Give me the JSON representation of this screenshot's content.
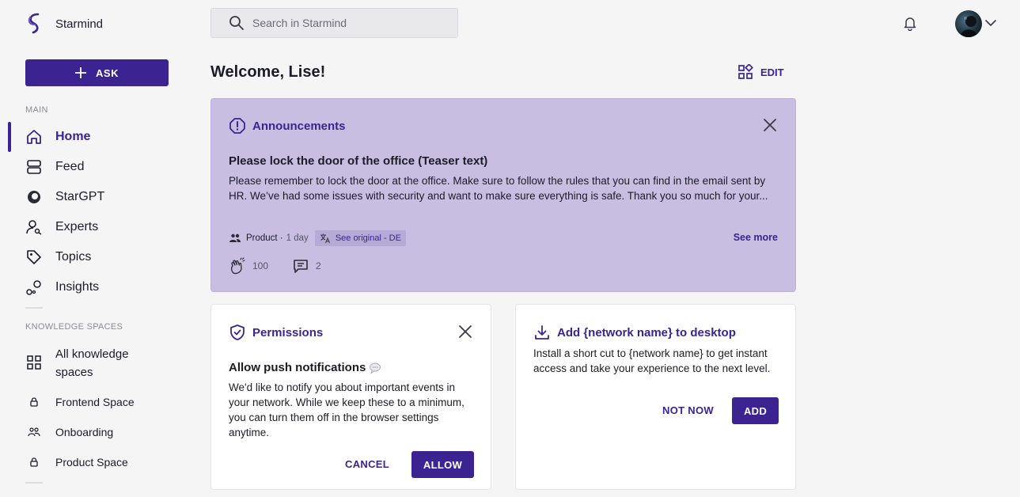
{
  "brand": {
    "name": "Starmind"
  },
  "sidebar": {
    "ask_label": "ASK",
    "main_label": "MAIN",
    "items": [
      {
        "label": "Home",
        "icon": "home-icon",
        "active": true
      },
      {
        "label": "Feed",
        "icon": "feed-icon"
      },
      {
        "label": "StarGPT",
        "icon": "stargpt-icon"
      },
      {
        "label": "Experts",
        "icon": "experts-icon"
      },
      {
        "label": "Topics",
        "icon": "tag-icon"
      },
      {
        "label": "Insights",
        "icon": "insights-icon"
      }
    ],
    "knowledge_label": "KNOWLEDGE SPACES",
    "spaces": [
      {
        "label": "All knowledge spaces",
        "icon": "grid-icon"
      },
      {
        "label": "Frontend Space",
        "icon": "lock-icon"
      },
      {
        "label": "Onboarding",
        "icon": "group-icon"
      },
      {
        "label": "Product Space",
        "icon": "lock-icon"
      }
    ]
  },
  "header": {
    "search_placeholder": "Search in Starmind"
  },
  "main": {
    "welcome": "Welcome,  Lise!",
    "edit_label": "EDIT",
    "announcement": {
      "heading": "Announcements",
      "title": "Please lock the door of the office (Teaser text)",
      "body": "Please remember to lock the door at the office. Make sure to follow the rules that you can find in the email sent by HR. We’ve had some issues with security and want to make sure everything is safe. Thank you so much for your...",
      "space": "Product ·",
      "time": "1 day",
      "see_original": "See original - DE",
      "see_more": "See more",
      "claps": "100",
      "comments": "2"
    },
    "permissions": {
      "heading": "Permissions",
      "title": "Allow push notifications",
      "body": "We'd like to notify you about important events in your network. While we keep these to a minimum, you can turn them off in the browser settings anytime.",
      "cancel": "CANCEL",
      "allow": "ALLOW"
    },
    "desktop": {
      "heading": "Add {network name} to desktop",
      "body": "Install a short cut to {network name} to get instant access and take your experience to the next level.",
      "not_now": "NOT NOW",
      "add": "ADD"
    }
  },
  "colors": {
    "accent": "#3b2391",
    "announcement_bg": "#c8bee2",
    "page_bg": "#f5f5f5"
  }
}
